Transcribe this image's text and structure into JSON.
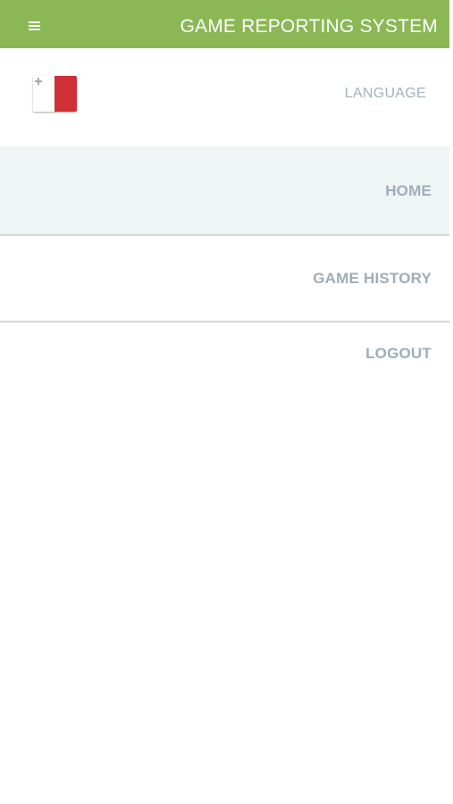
{
  "header": {
    "title": "GAME REPORTING SYSTEM",
    "menu_icon": "hamburger-icon",
    "background_color": "#8bb855"
  },
  "language": {
    "label": "LANGUAGE",
    "flag": "malta-flag-icon",
    "flag_colors": {
      "white": "#ffffff",
      "red": "#cf2f36"
    }
  },
  "navigation": {
    "items": [
      {
        "label": "HOME",
        "selected": true
      },
      {
        "label": "GAME HISTORY",
        "selected": false
      },
      {
        "label": "LOGOUT",
        "selected": false
      }
    ],
    "selected_background": "#eff4f5",
    "text_color": "#9eaeb9"
  }
}
